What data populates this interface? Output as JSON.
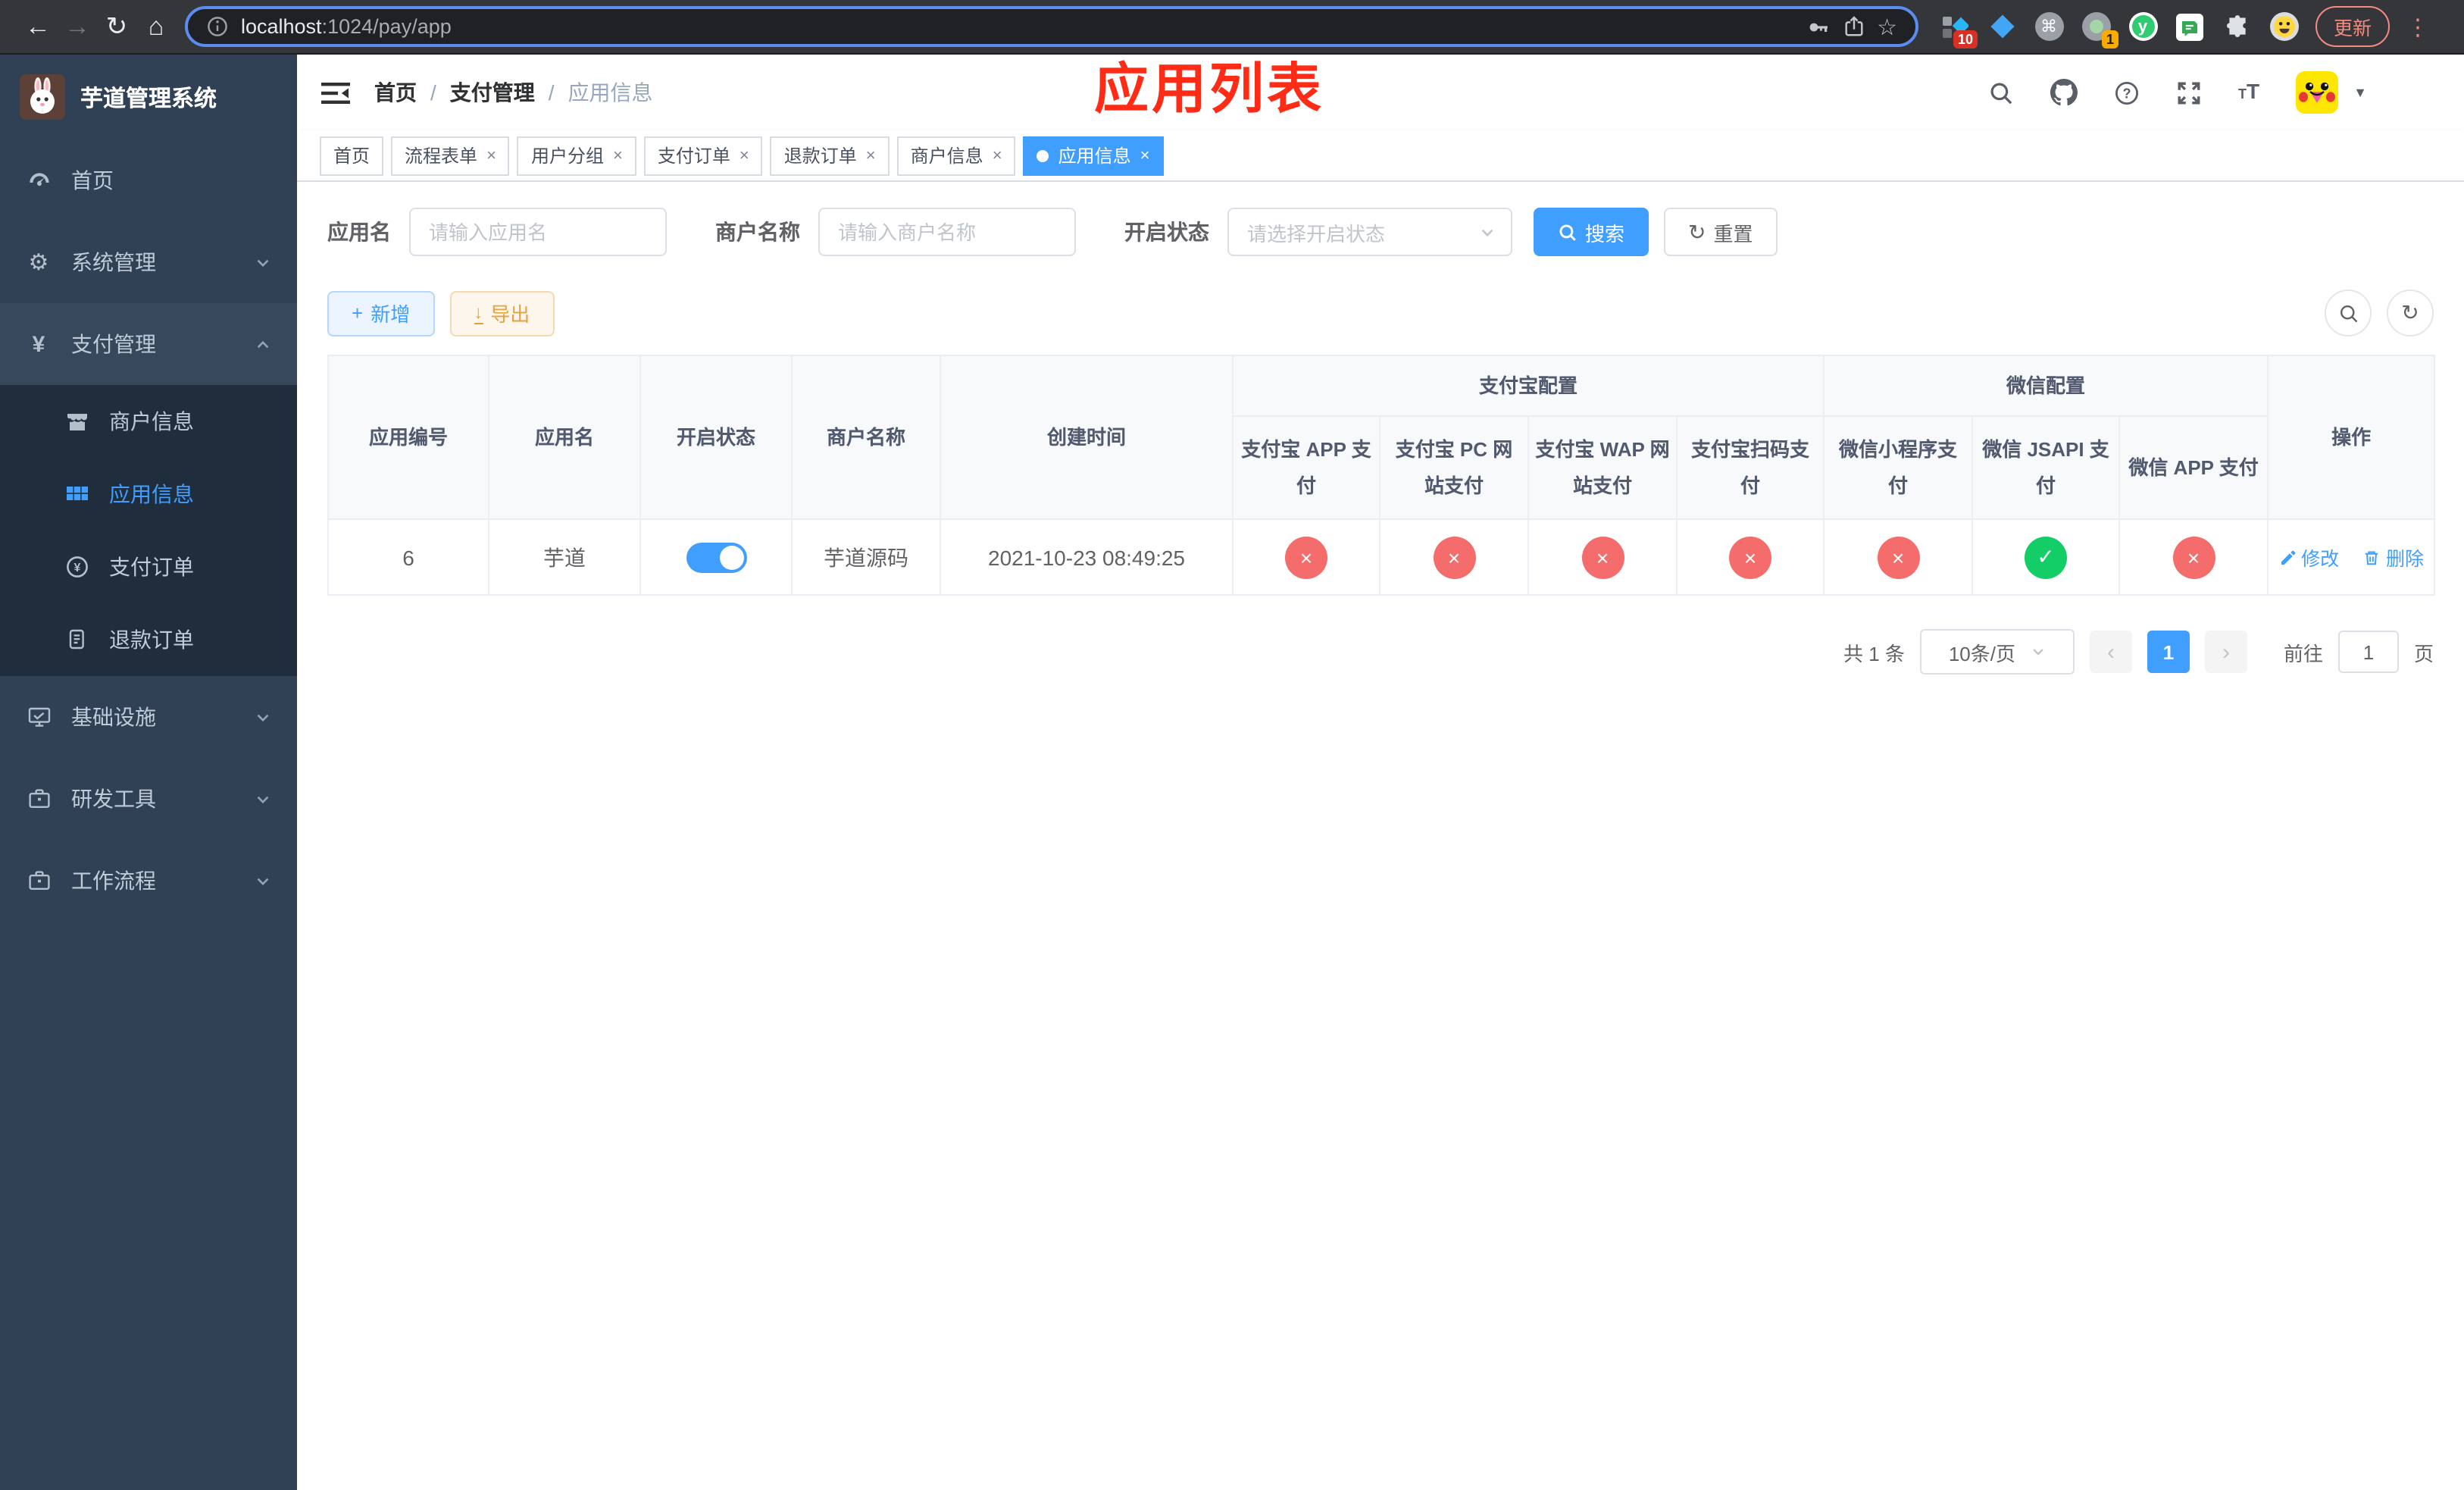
{
  "browser": {
    "url": {
      "host": "localhost",
      "path": ":1024/pay/app"
    },
    "update_label": "更新",
    "ext_badge_1": "10",
    "ext_badge_2": "1"
  },
  "sidebar": {
    "title": "芋道管理系统",
    "items": [
      {
        "label": "首页"
      },
      {
        "label": "系统管理"
      },
      {
        "label": "支付管理"
      },
      {
        "label": "商户信息"
      },
      {
        "label": "应用信息"
      },
      {
        "label": "支付订单"
      },
      {
        "label": "退款订单"
      },
      {
        "label": "基础设施"
      },
      {
        "label": "研发工具"
      },
      {
        "label": "工作流程"
      }
    ]
  },
  "breadcrumb": {
    "items": [
      "首页",
      "支付管理",
      "应用信息"
    ],
    "sep": "/"
  },
  "annotation": {
    "text": "应用列表",
    "color": "#fe2b16"
  },
  "tabs": [
    {
      "label": "首页"
    },
    {
      "label": "流程表单"
    },
    {
      "label": "用户分组"
    },
    {
      "label": "支付订单"
    },
    {
      "label": "退款订单"
    },
    {
      "label": "商户信息"
    },
    {
      "label": "应用信息"
    }
  ],
  "filters": {
    "app_name_label": "应用名",
    "app_name_placeholder": "请输入应用名",
    "merchant_label": "商户名称",
    "merchant_placeholder": "请输入商户名称",
    "status_label": "开启状态",
    "status_placeholder": "请选择开启状态",
    "search_label": "搜索",
    "reset_label": "重置"
  },
  "toolbar": {
    "add_label": "新增",
    "export_label": "导出"
  },
  "table": {
    "columns": [
      "应用编号",
      "应用名",
      "开启状态",
      "商户名称",
      "创建时间"
    ],
    "groups": [
      {
        "label": "支付宝配置",
        "children": [
          "支付宝 APP 支付",
          "支付宝 PC 网站支付",
          "支付宝 WAP 网站支付",
          "支付宝扫码支付"
        ]
      },
      {
        "label": "微信配置",
        "children": [
          "微信小程序支付",
          "微信 JSAPI 支付",
          "微信 APP 支付"
        ]
      }
    ],
    "actions_column": "操作",
    "row": {
      "id": "6",
      "name": "芋道",
      "enabled": true,
      "merchant": "芋道源码",
      "created_at": "2021-10-23 08:49:25",
      "channels": [
        false,
        false,
        false,
        false,
        false,
        true,
        false
      ],
      "actions": [
        "修改",
        "删除"
      ]
    }
  },
  "pagination": {
    "total_text": "共 1 条",
    "page_size": "10条/页",
    "current_page": "1",
    "goto_label": "前往",
    "goto_value": "1",
    "page_suffix": "页"
  },
  "colors": {
    "primary": "#409eff",
    "danger": "#f56c6c",
    "success": "#13ce66",
    "sidebar_bg": "#304156",
    "submenu_bg": "#1f2d3d"
  }
}
